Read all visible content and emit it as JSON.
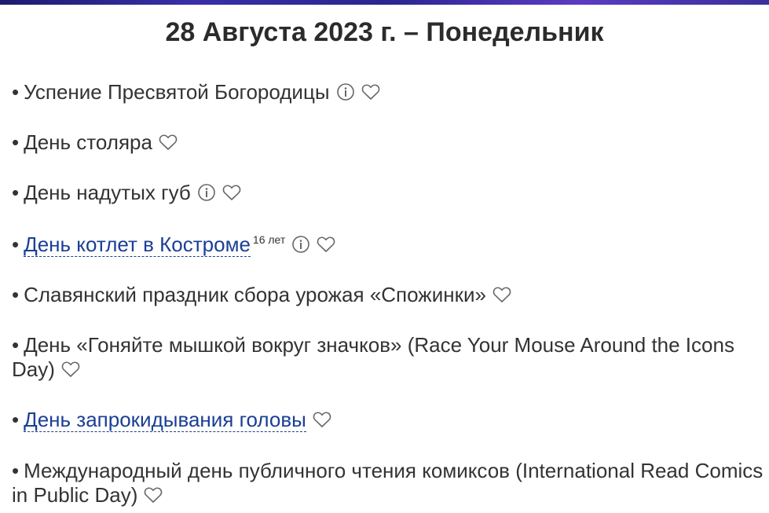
{
  "header": {
    "title": "28 Августа 2023 г. – Понедельник"
  },
  "holidays": [
    {
      "bullet": "•",
      "text": "Успение Пресвятой Богородицы",
      "link": false,
      "age": "",
      "icons": [
        "info-icon",
        "heart-icon"
      ]
    },
    {
      "bullet": "•",
      "text": "День столяра",
      "link": false,
      "age": "",
      "icons": [
        "heart-icon"
      ]
    },
    {
      "bullet": "•",
      "text": "День надутых губ",
      "link": false,
      "age": "",
      "icons": [
        "info-icon",
        "heart-icon"
      ]
    },
    {
      "bullet": "•",
      "text": "День котлет в Костроме",
      "link": true,
      "age": "16 лет",
      "icons": [
        "info-icon",
        "heart-icon"
      ]
    },
    {
      "bullet": "•",
      "text": "Славянский праздник сбора урожая «Спожинки»",
      "link": false,
      "age": "",
      "icons": [
        "heart-icon"
      ]
    },
    {
      "bullet": "•",
      "text": "День «Гоняйте мышкой вокруг значков» (Race Your Mouse Around the Icons Day)",
      "link": false,
      "age": "",
      "icons": [
        "heart-icon"
      ]
    },
    {
      "bullet": "•",
      "text": "День запрокидывания головы",
      "link": true,
      "age": "",
      "icons": [
        "heart-icon"
      ]
    },
    {
      "bullet": "•",
      "text": "Международный день публичного чтения комиксов (International Read Comics in Public Day)",
      "link": false,
      "age": "",
      "icons": [
        "heart-icon"
      ]
    }
  ],
  "colors": {
    "text": "#333333",
    "link": "#1a3f96",
    "icon": "#666666",
    "top_strip": "#2a2590"
  }
}
